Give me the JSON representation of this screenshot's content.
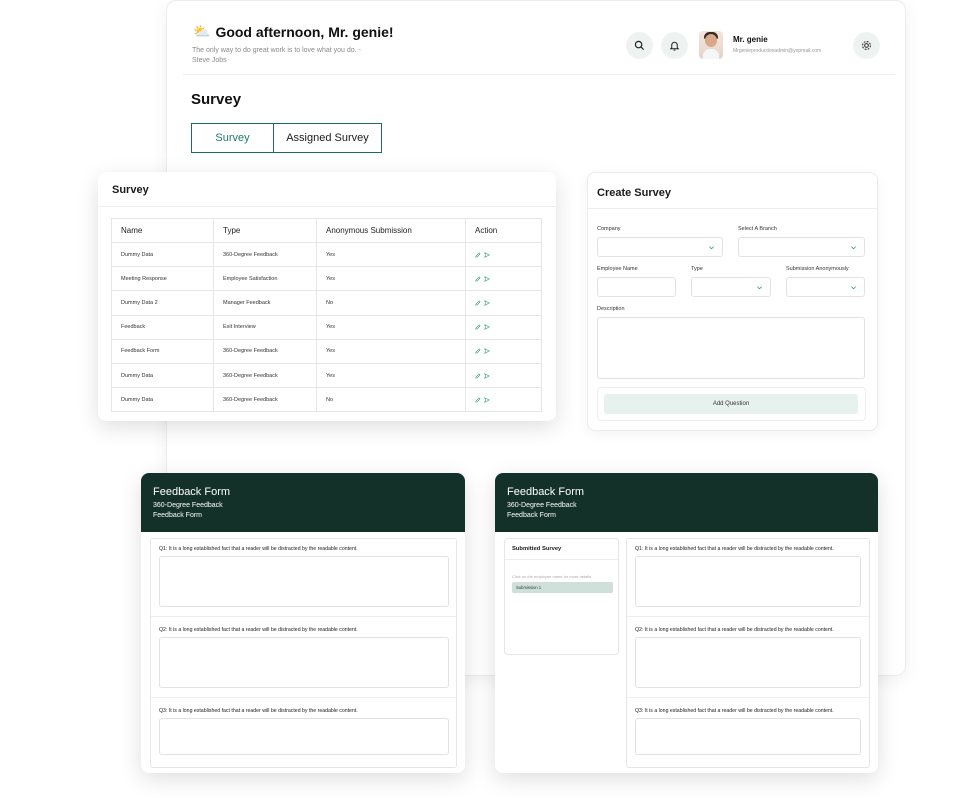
{
  "header": {
    "greeting": "Good afternoon, Mr. genie!",
    "quote": "The only way to do great work is to love what you do. - Steve Jobs",
    "user_name": "Mr. genie",
    "user_email": "Mrgenieproductionadmin@yopmail.com"
  },
  "page": {
    "title": "Survey",
    "tabs": [
      {
        "label": "Survey",
        "active": true
      },
      {
        "label": "Assigned Survey",
        "active": false
      }
    ]
  },
  "survey_table": {
    "title": "Survey",
    "columns": [
      "Name",
      "Type",
      "Anonymous Submission",
      "Action"
    ],
    "rows": [
      {
        "name": "Dummy Data",
        "type": "360-Degree Feedback",
        "anonymous": "Yes"
      },
      {
        "name": "Meeting Response",
        "type": "Employee Satisfaction",
        "anonymous": "Yes"
      },
      {
        "name": "Dummy Data 2",
        "type": "Manager Feedback",
        "anonymous": "No"
      },
      {
        "name": "Feedback",
        "type": "Exit Interview",
        "anonymous": "Yes"
      },
      {
        "name": "Feedback Form",
        "type": "360-Degree Feedback",
        "anonymous": "Yes"
      },
      {
        "name": "Dummy Data",
        "type": "360-Degree Feedback",
        "anonymous": "Yes"
      },
      {
        "name": "Dummy Data",
        "type": "360-Degree Feedback",
        "anonymous": "No"
      }
    ]
  },
  "create_survey": {
    "title": "Create Survey",
    "company_label": "Company",
    "branch_label": "Select A Branch",
    "employee_label": "Employee Name",
    "type_label": "Type",
    "anonymous_label": "Submission Anonymously",
    "description_label": "Description",
    "add_question_label": "Add Question"
  },
  "feedback_left": {
    "title": "Feedback Form",
    "subtitle1": "360-Degree Feedback",
    "subtitle2": "Feedback Form",
    "questions": [
      "Q1: It is a long established fact that a reader will be distracted by the readable content.",
      "Q2: It is a long established fact that a reader will be distracted by the readable content.",
      "Q3: It is a long established fact that a reader will be distracted by the readable content."
    ]
  },
  "feedback_right": {
    "title": "Feedback Form",
    "subtitle1": "360-Degree Feedback",
    "subtitle2": "Feedback Form",
    "submitted_title": "Submitted Survey",
    "submitted_hint": "Click on the employee name for more details",
    "submission_item": "Submission 1",
    "questions": [
      "Q1: It is a long established fact that a reader will be distracted by the readable content.",
      "Q2: It is a long established fact that a reader will be distracted by the readable content.",
      "Q3: It is a long established fact that a reader will be distracted by the readable content."
    ]
  },
  "colors": {
    "accent": "#1f7a68",
    "dark_header": "#143129",
    "icon_bg": "#eef3f1"
  },
  "icons": {
    "greeting": "sun-cloud-icon",
    "search": "search-icon",
    "notifications": "bell-icon",
    "settings": "gear-icon",
    "edit": "pencil-icon",
    "send": "send-icon",
    "dropdown": "chevron-down-icon"
  }
}
